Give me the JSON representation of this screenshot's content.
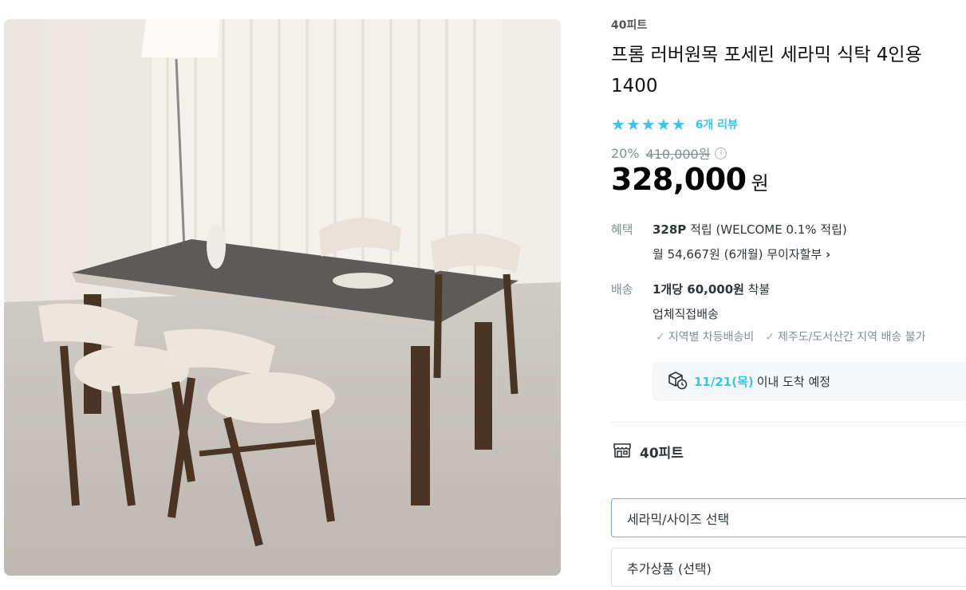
{
  "product": {
    "brand": "40피트",
    "title": "프롬 러버원목 포세린 세라믹 식탁 4인용 1400",
    "stars": 5,
    "review_link": "6개 리뷰",
    "discount": "20%",
    "original_price": "410,000원",
    "price": "328,000",
    "price_unit": "원"
  },
  "benefit": {
    "label": "혜택",
    "points": "328P",
    "points_rest": " 적립 (WELCOME 0.1% 적립)",
    "installment": "월 54,667원 (6개월) 무이자할부"
  },
  "shipping": {
    "label": "배송",
    "fee": "1개당 60,000원",
    "fee_rest": " 착불",
    "method": "업체직접배송",
    "note1": "지역별 차등배송비",
    "note2": "제주도/도서산간 지역 배송 불가",
    "arrival_date": "11/21(목)",
    "arrival_text": "이내 도착 예정"
  },
  "store": {
    "name": "40피트"
  },
  "options": {
    "primary": "세라믹/사이즈 선택",
    "secondary": "추가상품 (선택)"
  },
  "colors": {
    "accent": "#35c5f0",
    "muted": "#828c94"
  },
  "icons": {
    "star": "star-icon",
    "info": "info-icon",
    "chevron": "chevron-right-icon",
    "check": "check-icon",
    "delivery": "truck-clock-icon",
    "store": "storefront-icon"
  }
}
